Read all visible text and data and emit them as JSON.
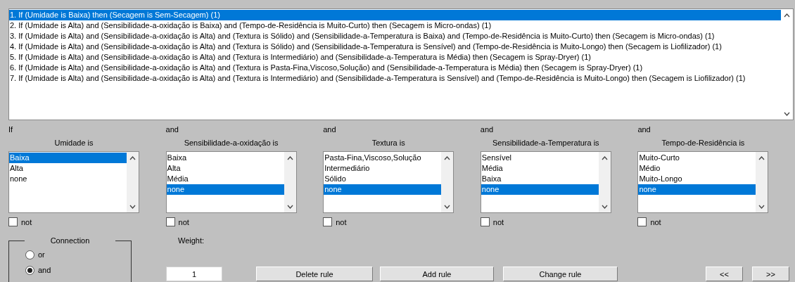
{
  "rules": [
    {
      "text": "1. If (Umidade is Baixa) then (Secagem is Sem-Secagem) (1)",
      "selected": true
    },
    {
      "text": "2. If (Umidade is Alta) and (Sensibilidade-a-oxidação is Baixa) and (Tempo-de-Residência is Muito-Curto) then (Secagem is Micro-ondas) (1)",
      "selected": false
    },
    {
      "text": "3. If (Umidade is Alta) and (Sensibilidade-a-oxidação is Alta) and (Textura is Sólido) and (Sensibilidade-a-Temperatura is Baixa) and (Tempo-de-Residência is Muito-Curto) then (Secagem is Micro-ondas) (1)",
      "selected": false
    },
    {
      "text": "4. If (Umidade is Alta) and (Sensibilidade-a-oxidação is Alta) and (Textura is Sólido) and (Sensibilidade-a-Temperatura is Sensível) and (Tempo-de-Residência is Muito-Longo) then (Secagem is Liofilizador) (1)",
      "selected": false
    },
    {
      "text": "5. If (Umidade is Alta) and (Sensibilidade-a-oxidação is Alta) and (Textura is Intermediário) and (Sensibilidade-a-Temperatura is Média) then (Secagem is Spray-Dryer) (1)",
      "selected": false
    },
    {
      "text": "6. If (Umidade is Alta) and (Sensibilidade-a-oxidação is Alta) and (Textura is Pasta-Fina,Viscoso,Solução) and (Sensibilidade-a-Temperatura is Média) then (Secagem is Spray-Dryer) (1)",
      "selected": false
    },
    {
      "text": "7. If (Umidade is Alta) and (Sensibilidade-a-oxidação is Alta) and (Textura is Intermediário) and (Sensibilidade-a-Temperatura is Sensível) and (Tempo-de-Residência is Muito-Longo) then (Secagem is Liofilizador) (1)",
      "selected": false
    }
  ],
  "variables": [
    {
      "connector": "If",
      "label": "Umidade is",
      "not_label": "not",
      "not": false,
      "options": [
        {
          "label": "Baixa",
          "selected": true
        },
        {
          "label": "Alta",
          "selected": false
        },
        {
          "label": "none",
          "selected": false
        }
      ]
    },
    {
      "connector": "and",
      "label": "Sensibilidade-a-oxidação is",
      "not_label": "not",
      "not": false,
      "options": [
        {
          "label": "Baixa",
          "selected": false
        },
        {
          "label": "Alta",
          "selected": false
        },
        {
          "label": "Média",
          "selected": false
        },
        {
          "label": "none",
          "selected": true
        }
      ]
    },
    {
      "connector": "and",
      "label": "Textura is",
      "not_label": "not",
      "not": false,
      "options": [
        {
          "label": "Pasta-Fina,Viscoso,Solução",
          "selected": false
        },
        {
          "label": "Intermediário",
          "selected": false
        },
        {
          "label": "Sólido",
          "selected": false
        },
        {
          "label": "none",
          "selected": true
        }
      ]
    },
    {
      "connector": "and",
      "label": "Sensibilidade-a-Temperatura is",
      "not_label": "not",
      "not": false,
      "options": [
        {
          "label": "Sensível",
          "selected": false
        },
        {
          "label": "Média",
          "selected": false
        },
        {
          "label": "Baixa",
          "selected": false
        },
        {
          "label": "none",
          "selected": true
        }
      ]
    },
    {
      "connector": "and",
      "label": "Tempo-de-Residência is",
      "not_label": "not",
      "not": false,
      "options": [
        {
          "label": "Muito-Curto",
          "selected": false
        },
        {
          "label": "Médio",
          "selected": false
        },
        {
          "label": "Muito-Longo",
          "selected": false
        },
        {
          "label": "none",
          "selected": true
        }
      ]
    }
  ],
  "connection": {
    "title": "Connection",
    "options": [
      {
        "label": "or",
        "selected": false
      },
      {
        "label": "and",
        "selected": true
      }
    ]
  },
  "weight": {
    "label": "Weight:",
    "value": "1"
  },
  "buttons": [
    "Delete rule",
    "Add rule",
    "Change rule"
  ],
  "nav_buttons": [
    "<<",
    ">>"
  ]
}
